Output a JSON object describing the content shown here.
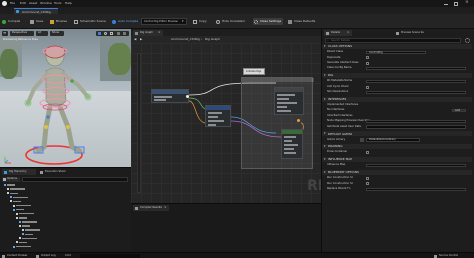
{
  "menubar": {
    "items": [
      "File",
      "Edit",
      "Asset",
      "Window",
      "Tools",
      "Help"
    ],
    "doc_tab": "Animmocat_CtrlRig"
  },
  "toolbar": {
    "buttons": [
      "Compile",
      "Save",
      "Browse",
      "Schematic Scene",
      "Auto Compile",
      "Control Rig Editor Preview",
      "Copy",
      "Hide Unrelated",
      "Class Settings",
      "Class Defaults"
    ],
    "dropdown_value": "Control Rig Editor Preview"
  },
  "viewport": {
    "controls": [
      "Perspective",
      "Lit",
      "Show"
    ],
    "subtitle": "Previewing Reference Pose"
  },
  "graph": {
    "tab_label": "Rig Graph",
    "breadcrumb_root": "Animmocat_CtrlRig",
    "breadcrumb_leaf": "Rig Graph",
    "watermark": "RIG",
    "comment_label": "Initialize Rigs"
  },
  "rig_hierarchy": {
    "tabs": [
      "Rig Hierarchy",
      "Execution Stack"
    ],
    "options_label": "Options"
  },
  "compiler": {
    "tab_label": "Compiler Results"
  },
  "details": {
    "tabs": [
      "Details",
      "Preview Scene Se"
    ],
    "search_placeholder": "Search Details",
    "sections": [
      {
        "title": "CLASS OPTIONS",
        "rows": [
          {
            "label": "Parent Class",
            "type": "dropdown",
            "value": "ControlRig"
          },
          {
            "label": "Deprecate",
            "type": "check"
          },
          {
            "label": "Generate Abstract Class",
            "type": "check"
          },
          {
            "label": "Class Config Name",
            "type": "field"
          }
        ]
      },
      {
        "title": "RIG",
        "rows": [
          {
            "label": "RC Metadata Name",
            "type": "field"
          },
          {
            "label": "Add Cycle Check",
            "type": "check"
          },
          {
            "label": "Skin Resolutions",
            "type": "field"
          }
        ]
      },
      {
        "title": "INTERFACES",
        "rows": [
          {
            "label": "Implemented Interfaces",
            "type": "text"
          },
          {
            "label": "No Interfaces",
            "type": "add",
            "button": "Add"
          },
          {
            "label": "Inherited Interfaces",
            "type": "text"
          },
          {
            "label": "Node Mapping Preview Overrides",
            "type": "field"
          },
          {
            "label": "Get Node Asset User Data",
            "type": "field"
          }
        ]
      },
      {
        "title": "DEFAULT GIZMO",
        "rows": [
          {
            "label": "Gizmo Library",
            "type": "asset",
            "value": "DefaultGizmoLibrary"
          }
        ]
      },
      {
        "title": "DRAWING",
        "rows": [
          {
            "label": "Draw Container",
            "type": "check"
          }
        ]
      },
      {
        "title": "INFLUENCE MAP",
        "rows": [
          {
            "label": "Influence Map",
            "type": "field"
          }
        ]
      },
      {
        "title": "BLUEPRINT OPTIONS",
        "rows": [
          {
            "label": "Run Construction Sc",
            "type": "check"
          },
          {
            "label": "Run Construction Sc",
            "type": "check"
          },
          {
            "label": "Replace Parent Fn",
            "type": "field"
          }
        ]
      }
    ]
  },
  "status_bar": {
    "items": [
      "Content Drawer",
      "Output Log",
      "Cmd"
    ],
    "source_control": "Source Control"
  }
}
